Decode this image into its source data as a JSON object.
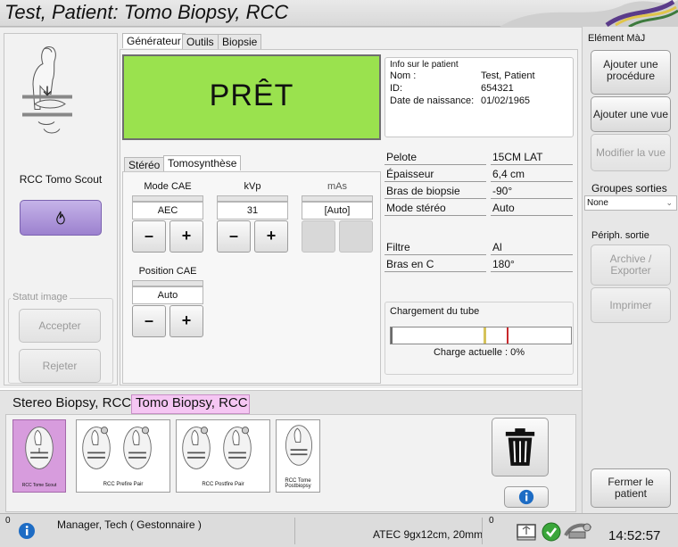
{
  "window": {
    "title": "Test, Patient:  Tomo Biopsy, RCC"
  },
  "left_panel": {
    "view_name": "RCC Tomo Scout",
    "image_status_label": "Statut image",
    "accept_label": "Accepter",
    "reject_label": "Rejeter"
  },
  "tabs": {
    "generator": "Générateur",
    "tools": "Outils",
    "biopsy": "Biopsie"
  },
  "status": {
    "ready_text": "PRÊT"
  },
  "patient_info": {
    "header": "Info sur le patient",
    "name_label": "Nom :",
    "name_value": "Test, Patient",
    "id_label": "ID:",
    "id_value": "654321",
    "dob_label": "Date de naissance:",
    "dob_value": "01/02/1965"
  },
  "subtabs": {
    "stereo": "Stéréo",
    "tomo": "Tomosynthèse"
  },
  "controls": {
    "mode_cae_label": "Mode CAE",
    "mode_cae_value": "AEC",
    "kvp_label": "kVp",
    "kvp_value": "31",
    "mas_label": "mAs",
    "mas_value": "[Auto]",
    "position_cae_label": "Position CAE",
    "position_cae_value": "Auto",
    "minus": "–",
    "plus": "+"
  },
  "params": [
    {
      "label": "Pelote",
      "value": "15CM LAT"
    },
    {
      "label": "Épaisseur",
      "value": "6,4 cm"
    },
    {
      "label": "Bras de biopsie",
      "value": "-90°"
    },
    {
      "label": "Mode stéréo",
      "value": "Auto"
    },
    {
      "label": "Filtre",
      "value": "Al"
    },
    {
      "label": "Bras en C",
      "value": "180°"
    }
  ],
  "tube": {
    "header": "Chargement du tube",
    "charge_text": "Charge actuelle : 0%",
    "charge_percent": 0
  },
  "right_panel": {
    "element_header": "Elément MàJ",
    "add_procedure": "Ajouter une procédure",
    "add_view": "Ajouter une vue",
    "modify_view": "Modifier la vue",
    "output_groups_label": "Groupes sorties",
    "output_groups_value": "None",
    "output_device_label": "Périph. sortie",
    "archive_export": "Archive / Exporter",
    "print": "Imprimer",
    "close_patient": "Fermer le patient"
  },
  "procedures": {
    "tab1": "Stereo Biopsy, RCC",
    "tab2": "Tomo Biopsy, RCC"
  },
  "thumbnails": [
    {
      "label": "RCC Tome Scout"
    },
    {
      "label": "RCC Prefire Pair"
    },
    {
      "label": "RCC Postfire Pair"
    },
    {
      "label": "RCC Tome Postbiopsy"
    }
  ],
  "statusbar": {
    "count_left": "0",
    "user": "Manager, Tech ( Gestonnaire )",
    "collimator": "ATEC 9gx12cm, 20mm",
    "count_right": "0",
    "time": "14:52:57"
  },
  "colors": {
    "ready_green": "#9ae24e",
    "purple": "#a98ed6",
    "tab_pink": "#f5c6f3",
    "info_blue": "#1d6cc4"
  }
}
